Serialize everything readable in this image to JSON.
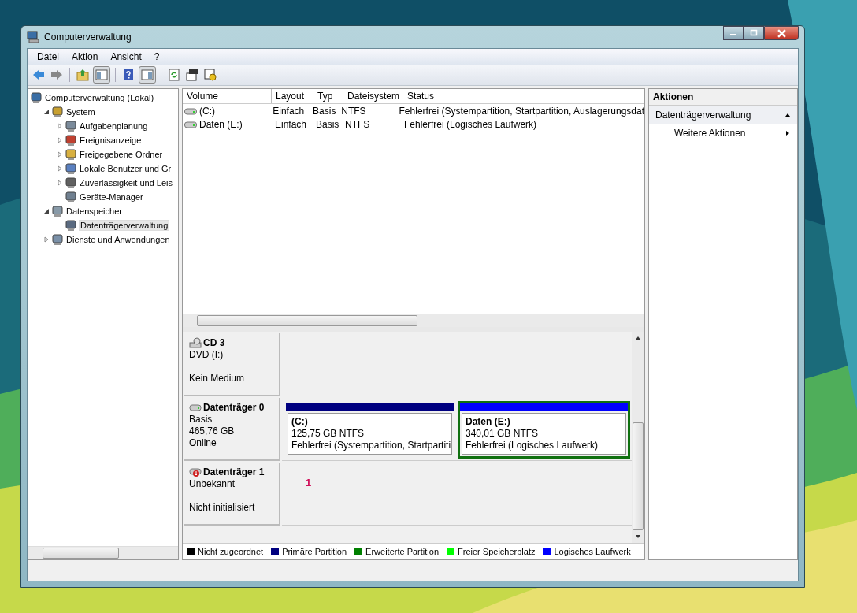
{
  "window": {
    "title": "Computerverwaltung"
  },
  "menu": [
    "Datei",
    "Aktion",
    "Ansicht",
    "?"
  ],
  "tree": [
    {
      "label": "Computerverwaltung (Lokal)",
      "selected": false,
      "children": [
        {
          "label": "System",
          "selected": false,
          "expanded": true,
          "children": [
            {
              "label": "Aufgabenplanung",
              "selected": false,
              "expanded": false
            },
            {
              "label": "Ereignisanzeige",
              "selected": false,
              "expanded": false
            },
            {
              "label": "Freigegebene Ordner",
              "selected": false,
              "expanded": false
            },
            {
              "label": "Lokale Benutzer und Gr",
              "selected": false,
              "expanded": false
            },
            {
              "label": "Zuverlässigkeit und Leis",
              "selected": false,
              "expanded": false
            },
            {
              "label": "Geräte-Manager",
              "selected": false
            }
          ]
        },
        {
          "label": "Datenspeicher",
          "selected": false,
          "expanded": true,
          "children": [
            {
              "label": "Datenträgerverwaltung",
              "selected": true
            }
          ]
        },
        {
          "label": "Dienste und Anwendungen",
          "selected": false,
          "expanded": false
        }
      ]
    }
  ],
  "table": {
    "columns": [
      "Volume",
      "Layout",
      "Typ",
      "Dateisystem",
      "Status"
    ],
    "rows": [
      [
        "(C:)",
        "Einfach",
        "Basis",
        "NTFS",
        "Fehlerfrei (Systempartition, Startpartition, Auslagerungsdat"
      ],
      [
        "Daten (E:)",
        "Einfach",
        "Basis",
        "NTFS",
        "Fehlerfrei (Logisches Laufwerk)"
      ]
    ]
  },
  "disks": [
    {
      "kind": "cdrom",
      "name": "CD 3",
      "lines": [
        "DVD (I:)"
      ],
      "status": "Kein Medium"
    },
    {
      "kind": "disk",
      "name": "Datenträger 0",
      "lines": [
        "Basis",
        "465,76 GB"
      ],
      "status": "Online",
      "partitions": [
        {
          "name": "(C:)",
          "size": "125,75 GB NTFS",
          "status": "Fehlerfrei (Systempartition, Startpartiti",
          "color": "#000080",
          "selected": false
        },
        {
          "name": "Daten  (E:)",
          "size": "340,01 GB NTFS",
          "status": "Fehlerfrei (Logisches Laufwerk)",
          "color": "#0000ff",
          "selected": true
        }
      ]
    },
    {
      "kind": "unknown",
      "name": "Datenträger 1",
      "lines": [
        "Unbekannt"
      ],
      "status": "Nicht initialisiert",
      "note": "1"
    }
  ],
  "legend": [
    {
      "label": "Nicht zugeordnet",
      "color": "#000000"
    },
    {
      "label": "Primäre Partition",
      "color": "#000080"
    },
    {
      "label": "Erweiterte Partition",
      "color": "#008000"
    },
    {
      "label": "Freier Speicherplatz",
      "color": "#00ff00"
    },
    {
      "label": "Logisches Laufwerk",
      "color": "#0000ff"
    }
  ],
  "actions": {
    "title": "Aktionen",
    "section": "Datenträgerverwaltung",
    "expanded": true,
    "items": [
      "Weitere Aktionen"
    ]
  }
}
